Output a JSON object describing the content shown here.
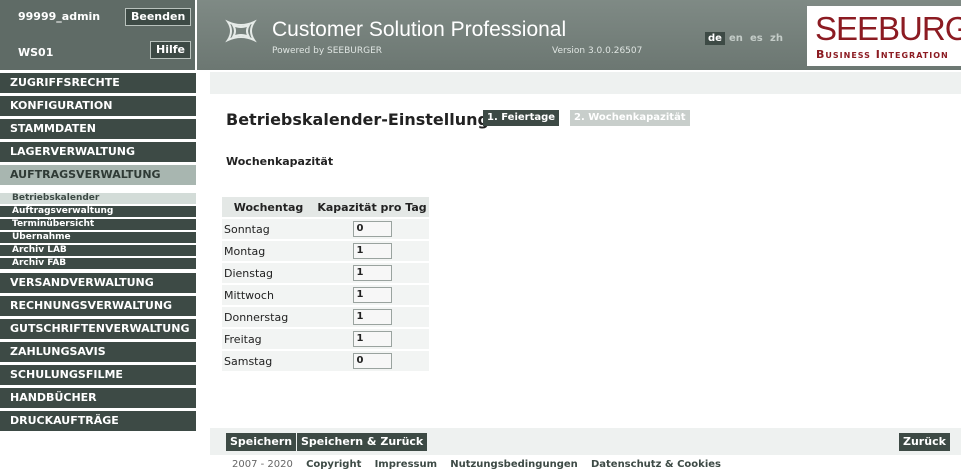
{
  "user": {
    "name": "99999_admin",
    "workstation": "WS01",
    "logout_label": "Beenden",
    "help_label": "Hilfe"
  },
  "header": {
    "title": "Customer Solution Professional",
    "subtitle": "Powered by SEEBURGER",
    "version": "Version 3.0.0.26507",
    "languages": [
      "de",
      "en",
      "es",
      "zh"
    ],
    "active_language": "de",
    "brand_top": "SEEBURGER",
    "brand_bottom": "Business Integration"
  },
  "sidebar": {
    "items": [
      "ZUGRIFFSRECHTE",
      "KONFIGURATION",
      "STAMMDATEN",
      "LAGERVERWALTUNG",
      "AUFTRAGSVERWALTUNG",
      "VERSANDVERWALTUNG",
      "RECHNUNGSVERWALTUNG",
      "GUTSCHRIFTENVERWALTUNG",
      "ZAHLUNGSAVIS",
      "SCHULUNGSFILME",
      "HANDBÜCHER",
      "DRUCKAUFTRÄGE"
    ],
    "active_item": "AUFTRAGSVERWALTUNG",
    "subitems": [
      "Betriebskalender",
      "Auftragsverwaltung",
      "Terminübersicht",
      "Übernahme",
      "Archiv LAB",
      "Archiv FAB"
    ],
    "active_subitem": "Betriebskalender"
  },
  "page": {
    "title": "Betriebskalender-Einstellungen",
    "tabs": [
      "1. Feiertage",
      "2. Wochenkapazität"
    ],
    "section_title": "Wochenkapazität",
    "table": {
      "headers": [
        "Wochentag",
        "Kapazität pro Tag"
      ],
      "rows": [
        {
          "day": "Sonntag",
          "value": "0"
        },
        {
          "day": "Montag",
          "value": "1"
        },
        {
          "day": "Dienstag",
          "value": "1"
        },
        {
          "day": "Mittwoch",
          "value": "1"
        },
        {
          "day": "Donnerstag",
          "value": "1"
        },
        {
          "day": "Freitag",
          "value": "1"
        },
        {
          "day": "Samstag",
          "value": "0"
        }
      ]
    }
  },
  "actions": {
    "save": "Speichern",
    "save_back": "Speichern & Zurück",
    "back": "Zurück"
  },
  "footer": {
    "years": "2007 - 2020",
    "links": [
      "Copyright",
      "Impressum",
      "Nutzungsbedingungen",
      "Datenschutz & Cookies"
    ]
  },
  "colors": {
    "nav_dark": "#3d4a45",
    "nav_active": "#a8b6b0",
    "brand_red": "#8c1b22",
    "header_bg": "#737e79"
  }
}
